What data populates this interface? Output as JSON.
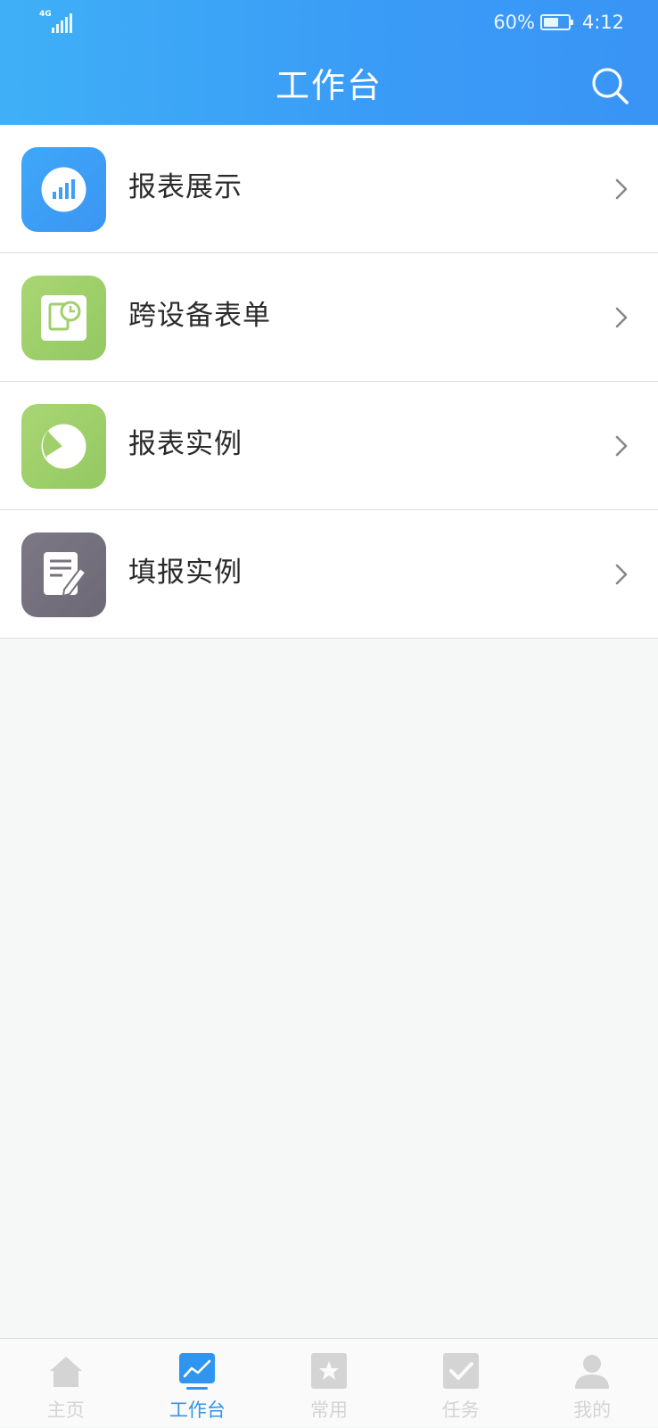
{
  "status_bar": {
    "network": "4G",
    "battery_percent": "60%",
    "battery_level": 0.6,
    "time": "4:12"
  },
  "header": {
    "title": "工作台",
    "search_icon": "search-icon"
  },
  "items": [
    {
      "label": "报表展示",
      "icon": "bar-chart-icon",
      "color": "#3f9ff6"
    },
    {
      "label": "跨设备表单",
      "icon": "clock-document-icon",
      "color": "#9fd06a"
    },
    {
      "label": "报表实例",
      "icon": "pie-chart-icon",
      "color": "#9fd06a"
    },
    {
      "label": "填报实例",
      "icon": "edit-form-icon",
      "color": "#77727e"
    }
  ],
  "tabs": [
    {
      "label": "主页",
      "icon": "home-icon",
      "active": false
    },
    {
      "label": "工作台",
      "icon": "line-chart-icon",
      "active": true
    },
    {
      "label": "常用",
      "icon": "star-icon",
      "active": false
    },
    {
      "label": "任务",
      "icon": "check-icon",
      "active": false
    },
    {
      "label": "我的",
      "icon": "user-icon",
      "active": false
    }
  ],
  "colors": {
    "header_start": "#3fb0f7",
    "header_end": "#3994f5",
    "active_tab": "#2f95ee",
    "inactive_tab": "#d4d4d4"
  }
}
